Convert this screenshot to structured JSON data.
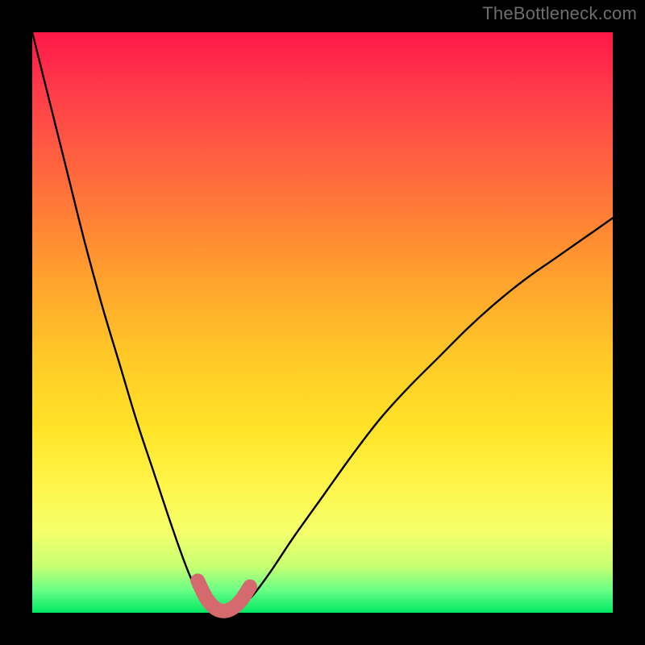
{
  "watermark": "TheBottleneck.com",
  "gradient_colors": {
    "top": "#ff1848",
    "mid_upper": "#ff9a2f",
    "mid": "#ffe327",
    "lower": "#c8ff73",
    "bottom": "#00e865"
  },
  "chart_data": {
    "type": "line",
    "title": "",
    "xlabel": "",
    "ylabel": "",
    "xlim": [
      0,
      100
    ],
    "ylim": [
      0,
      100
    ],
    "annotations": [
      "TheBottleneck.com"
    ],
    "series": [
      {
        "name": "bottleneck-curve",
        "color": "#000000",
        "x": [
          0,
          3,
          6,
          9,
          12,
          15,
          18,
          21,
          24,
          26.5,
          28.5,
          30,
          31.5,
          33,
          34.5,
          36,
          38,
          41,
          45,
          50,
          55,
          60,
          65,
          70,
          75,
          80,
          85,
          90,
          95,
          100
        ],
        "y": [
          100,
          88,
          76,
          64,
          53,
          43,
          33,
          24,
          15,
          8,
          3.5,
          1.5,
          0.5,
          0.3,
          0.5,
          1.3,
          3,
          7,
          13,
          20,
          27,
          33.5,
          39,
          44,
          49,
          53.5,
          57.5,
          61,
          64.5,
          68
        ]
      },
      {
        "name": "highlight-band",
        "color": "#d46a6e",
        "x": [
          28.5,
          30,
          31.5,
          33,
          34.5,
          36,
          37.5
        ],
        "y": [
          5.5,
          2.5,
          0.8,
          0.3,
          0.8,
          2.2,
          4.5
        ]
      }
    ],
    "minimum_point": {
      "x": 33,
      "y": 0.3
    }
  }
}
